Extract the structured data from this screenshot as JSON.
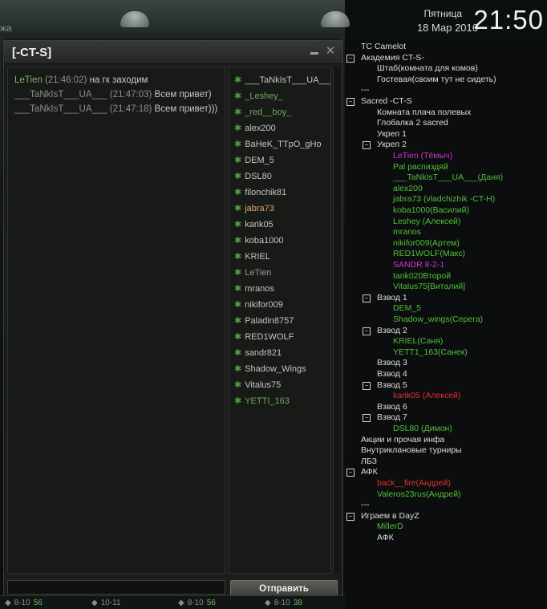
{
  "clock": {
    "day": "Пятница",
    "date": "18 Мар 2016",
    "time": "21:50"
  },
  "backdrop": {
    "edge_text": "жа"
  },
  "chat": {
    "title": "[-CT-S]",
    "messages": [
      {
        "author": "LeTien",
        "time": "(21:46:02)",
        "text": "на гк заходим",
        "author_color": "green"
      },
      {
        "author": "___TaNkIsT___UA___",
        "time": "(21:47:03)",
        "text": "Всем привет)",
        "author_color": "grey"
      },
      {
        "author": "___TaNkIsT___UA___",
        "time": "(21:47:18)",
        "text": "Всем привет)))",
        "author_color": "grey"
      }
    ],
    "members": [
      {
        "name": "___TaNkIsT___UA___",
        "style": "normal"
      },
      {
        "name": "_Leshey_",
        "style": "green"
      },
      {
        "name": "_red__boy_",
        "style": "green"
      },
      {
        "name": "alex200",
        "style": "normal"
      },
      {
        "name": "BaHeK_TTpO_gHo",
        "style": "normal"
      },
      {
        "name": "DEM_5",
        "style": "normal"
      },
      {
        "name": "DSL80",
        "style": "normal"
      },
      {
        "name": "filonchik81",
        "style": "normal"
      },
      {
        "name": "jabra73",
        "style": "me"
      },
      {
        "name": "karik05",
        "style": "normal"
      },
      {
        "name": "koba1000",
        "style": "normal"
      },
      {
        "name": "KRIEL",
        "style": "normal"
      },
      {
        "name": "LeTien",
        "style": "dim"
      },
      {
        "name": "mranos",
        "style": "normal"
      },
      {
        "name": "nikifor009",
        "style": "normal"
      },
      {
        "name": "Paladin8757",
        "style": "normal"
      },
      {
        "name": "RED1WOLF",
        "style": "normal"
      },
      {
        "name": "sandr821",
        "style": "normal"
      },
      {
        "name": "Shadow_Wings",
        "style": "normal"
      },
      {
        "name": "Vitalus75",
        "style": "normal"
      },
      {
        "name": "YETTI_163",
        "style": "green"
      }
    ],
    "input_value": "",
    "send_label": "Отправить"
  },
  "bottom_strip": [
    {
      "label": "8-10",
      "num": "56"
    },
    {
      "label": "10-11",
      "num": ""
    },
    {
      "label": "8-10",
      "num": "56"
    },
    {
      "label": "8-10",
      "num": "38"
    }
  ],
  "teamspeak": {
    "rows": [
      {
        "text": "TC Camelot",
        "indent": 1,
        "color": "white",
        "toggle": ""
      },
      {
        "text": "Академия CT-S-",
        "indent": 1,
        "color": "white",
        "toggle": "−"
      },
      {
        "text": "Штаб(комната для комов)",
        "indent": 3,
        "color": "white",
        "toggle": ""
      },
      {
        "text": "Гостевая(своим тут не сидеть)",
        "indent": 3,
        "color": "white",
        "toggle": ""
      },
      {
        "text": "---",
        "indent": 1,
        "color": "white",
        "toggle": ""
      },
      {
        "text": "Sacred -CT-S",
        "indent": 1,
        "color": "white",
        "toggle": "−"
      },
      {
        "text": "Комната плача полевых",
        "indent": 3,
        "color": "white",
        "toggle": ""
      },
      {
        "text": "Глобалка 2 sacred",
        "indent": 3,
        "color": "white",
        "toggle": ""
      },
      {
        "text": "Укреп 1",
        "indent": 3,
        "color": "white",
        "toggle": ""
      },
      {
        "text": "Укреп 2",
        "indent": 3,
        "color": "white",
        "toggle": "−"
      },
      {
        "text": "LeTien (Тёмыч)",
        "indent": 5,
        "color": "magenta",
        "toggle": ""
      },
      {
        "text": "Pal распиздяй",
        "indent": 5,
        "color": "green",
        "toggle": ""
      },
      {
        "text": "___TaNkIsT___UA___(Даня)",
        "indent": 5,
        "color": "green",
        "toggle": ""
      },
      {
        "text": "alex200",
        "indent": 5,
        "color": "green",
        "toggle": ""
      },
      {
        "text": "jabra73 (vladchizhik -CT-H)",
        "indent": 5,
        "color": "green",
        "toggle": ""
      },
      {
        "text": "koba1000(Василий)",
        "indent": 5,
        "color": "green",
        "toggle": ""
      },
      {
        "text": "Leshey (Алексей)",
        "indent": 5,
        "color": "green",
        "toggle": ""
      },
      {
        "text": "mranos",
        "indent": 5,
        "color": "green",
        "toggle": ""
      },
      {
        "text": "nikifor009(Артем)",
        "indent": 5,
        "color": "green",
        "toggle": ""
      },
      {
        "text": "RED1WOLF(Макс)",
        "indent": 5,
        "color": "green",
        "toggle": ""
      },
      {
        "text": "SANDR 8-2-1",
        "indent": 5,
        "color": "magenta",
        "toggle": ""
      },
      {
        "text": "tank020Второй",
        "indent": 5,
        "color": "green",
        "toggle": ""
      },
      {
        "text": "Vitalus75[Виталий]",
        "indent": 5,
        "color": "green",
        "toggle": ""
      },
      {
        "text": "Взвод 1",
        "indent": 3,
        "color": "white",
        "toggle": "−"
      },
      {
        "text": "DEM_5",
        "indent": 5,
        "color": "green",
        "toggle": ""
      },
      {
        "text": "Shadow_wings(Серега)",
        "indent": 5,
        "color": "green",
        "toggle": ""
      },
      {
        "text": "Взвод 2",
        "indent": 3,
        "color": "white",
        "toggle": "−"
      },
      {
        "text": "KRIEL(Саня)",
        "indent": 5,
        "color": "green",
        "toggle": ""
      },
      {
        "text": "YETT1_163(Санек)",
        "indent": 5,
        "color": "green",
        "toggle": ""
      },
      {
        "text": "Взвод 3",
        "indent": 3,
        "color": "white",
        "toggle": ""
      },
      {
        "text": "Взвод 4",
        "indent": 3,
        "color": "white",
        "toggle": ""
      },
      {
        "text": "Взвод 5",
        "indent": 3,
        "color": "white",
        "toggle": "−"
      },
      {
        "text": "karik05 (Алексей)",
        "indent": 5,
        "color": "red",
        "toggle": ""
      },
      {
        "text": "Взвод 6",
        "indent": 3,
        "color": "white",
        "toggle": ""
      },
      {
        "text": "Взвод 7",
        "indent": 3,
        "color": "white",
        "toggle": "−"
      },
      {
        "text": "DSL80 (Димон)",
        "indent": 5,
        "color": "green",
        "toggle": ""
      },
      {
        "text": "Акции и прочая инфа",
        "indent": 1,
        "color": "white",
        "toggle": ""
      },
      {
        "text": "Внутриклановые турниры",
        "indent": 1,
        "color": "white",
        "toggle": ""
      },
      {
        "text": "ЛБЗ",
        "indent": 1,
        "color": "white",
        "toggle": ""
      },
      {
        "text": "АФК",
        "indent": 1,
        "color": "white",
        "toggle": "−"
      },
      {
        "text": "back__fire(Андрей)",
        "indent": 3,
        "color": "red",
        "toggle": ""
      },
      {
        "text": "Valeros23rus(Андрей)",
        "indent": 3,
        "color": "green",
        "toggle": ""
      },
      {
        "text": "---",
        "indent": 1,
        "color": "white",
        "toggle": ""
      },
      {
        "text": "Играем в DayZ",
        "indent": 1,
        "color": "white",
        "toggle": "−"
      },
      {
        "text": "MillerD",
        "indent": 3,
        "color": "green",
        "toggle": ""
      },
      {
        "text": "АФК",
        "indent": 3,
        "color": "white",
        "toggle": ""
      }
    ]
  }
}
